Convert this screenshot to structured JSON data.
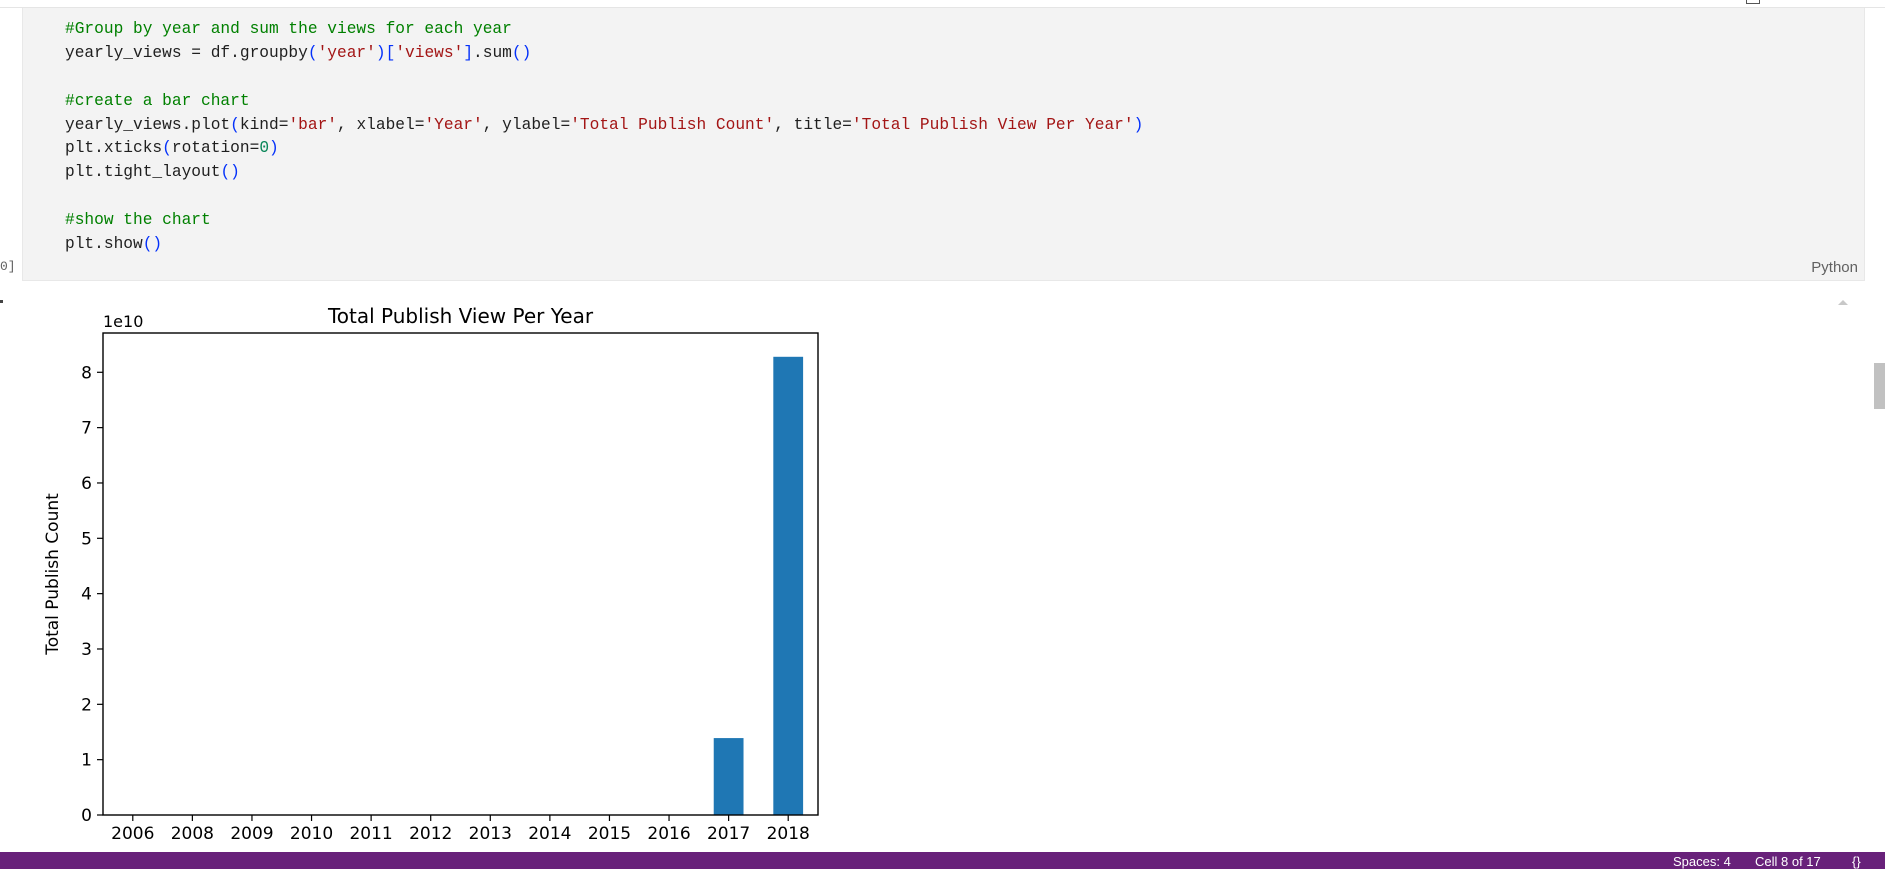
{
  "code": {
    "lines": [
      [
        {
          "t": "#Group by year and sum the views for each year",
          "c": "com"
        }
      ],
      [
        {
          "t": "yearly_views = df.groupby",
          "c": ""
        },
        {
          "t": "(",
          "c": "par"
        },
        {
          "t": "'year'",
          "c": "str"
        },
        {
          "t": ")[",
          "c": "par"
        },
        {
          "t": "'views'",
          "c": "str"
        },
        {
          "t": "]",
          "c": "par"
        },
        {
          "t": ".sum",
          "c": ""
        },
        {
          "t": "()",
          "c": "par"
        }
      ],
      [],
      [
        {
          "t": "#create a bar chart",
          "c": "com"
        }
      ],
      [
        {
          "t": "yearly_views.plot",
          "c": ""
        },
        {
          "t": "(",
          "c": "par"
        },
        {
          "t": "kind=",
          "c": ""
        },
        {
          "t": "'bar'",
          "c": "str"
        },
        {
          "t": ", xlabel=",
          "c": ""
        },
        {
          "t": "'Year'",
          "c": "str"
        },
        {
          "t": ", ylabel=",
          "c": ""
        },
        {
          "t": "'Total Publish Count'",
          "c": "str"
        },
        {
          "t": ", title=",
          "c": ""
        },
        {
          "t": "'Total Publish View Per Year'",
          "c": "str"
        },
        {
          "t": ")",
          "c": "par"
        }
      ],
      [
        {
          "t": "plt.xticks",
          "c": ""
        },
        {
          "t": "(",
          "c": "par"
        },
        {
          "t": "rotation=",
          "c": ""
        },
        {
          "t": "0",
          "c": "num"
        },
        {
          "t": ")",
          "c": "par"
        }
      ],
      [
        {
          "t": "plt.tight_layout",
          "c": ""
        },
        {
          "t": "()",
          "c": "par"
        }
      ],
      [],
      [
        {
          "t": "#show the chart",
          "c": "com"
        }
      ],
      [
        {
          "t": "plt.show",
          "c": ""
        },
        {
          "t": "()",
          "c": "par"
        }
      ]
    ],
    "language": "Python",
    "exec_count": "0]"
  },
  "status_bar": {
    "spaces": "Spaces: 4",
    "cell": "Cell 8 of 17",
    "braces": "{}"
  },
  "colors": {
    "bar": "#1f77b4",
    "status_bar": "#68217a"
  },
  "chart_data": {
    "type": "bar",
    "title": "Total Publish View Per Year",
    "xlabel": "Year",
    "ylabel": "Total Publish Count",
    "offset_label": "1e10",
    "categories": [
      "2006",
      "2008",
      "2009",
      "2010",
      "2011",
      "2012",
      "2013",
      "2014",
      "2015",
      "2016",
      "2017",
      "2018"
    ],
    "values": [
      0,
      0,
      0,
      0,
      0,
      0,
      0,
      0,
      0,
      0,
      1.39,
      8.28
    ],
    "yticks": [
      "0",
      "1",
      "2",
      "3",
      "4",
      "5",
      "6",
      "7",
      "8"
    ],
    "ylim": [
      0,
      8.71
    ],
    "grid": false,
    "legend": "none"
  }
}
